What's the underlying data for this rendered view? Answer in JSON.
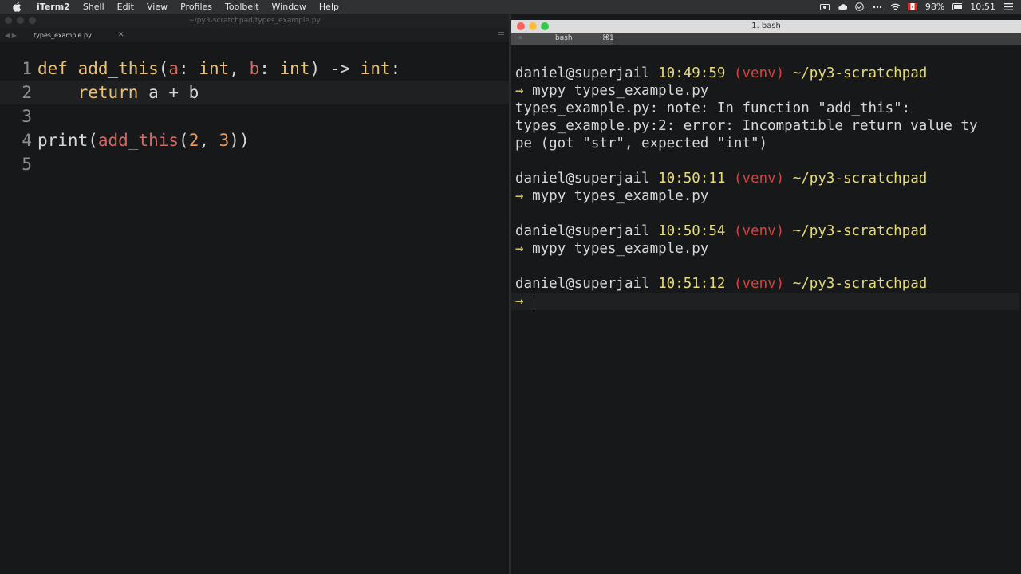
{
  "menubar": {
    "app": "iTerm2",
    "items": [
      "Shell",
      "Edit",
      "View",
      "Profiles",
      "Toolbelt",
      "Window",
      "Help"
    ],
    "battery": "98%",
    "clock": "10:51"
  },
  "editor": {
    "window_title": "~/py3-scratchpad/types_example.py",
    "tab_label": "types_example.py",
    "lines": [
      {
        "num": "1",
        "tokens": [
          {
            "t": "def ",
            "c": "kw"
          },
          {
            "t": "add_this",
            "c": "fn"
          },
          {
            "t": "(",
            "c": "pl"
          },
          {
            "t": "a",
            "c": "par"
          },
          {
            "t": ": ",
            "c": "pl"
          },
          {
            "t": "int",
            "c": "typ"
          },
          {
            "t": ", ",
            "c": "pl"
          },
          {
            "t": "b",
            "c": "par"
          },
          {
            "t": ": ",
            "c": "pl"
          },
          {
            "t": "int",
            "c": "typ"
          },
          {
            "t": ") -> ",
            "c": "pl"
          },
          {
            "t": "int",
            "c": "typ"
          },
          {
            "t": ":",
            "c": "pl"
          }
        ]
      },
      {
        "num": "2",
        "current": true,
        "tokens": [
          {
            "t": "    return",
            "c": "kw"
          },
          {
            "t": " a + b",
            "c": "pl"
          }
        ]
      },
      {
        "num": "3",
        "tokens": []
      },
      {
        "num": "4",
        "tokens": [
          {
            "t": "print",
            "c": "pl"
          },
          {
            "t": "(",
            "c": "pl"
          },
          {
            "t": "add_this",
            "c": "par"
          },
          {
            "t": "(",
            "c": "pl"
          },
          {
            "t": "2",
            "c": "num"
          },
          {
            "t": ", ",
            "c": "pl"
          },
          {
            "t": "3",
            "c": "num"
          },
          {
            "t": "))",
            "c": "pl"
          }
        ]
      },
      {
        "num": "5",
        "tokens": []
      }
    ]
  },
  "terminal": {
    "window_title": "1. bash",
    "tab_label": "bash",
    "tab_shortcut": "⌘1",
    "arrow": "→",
    "blocks": [
      {
        "user": "daniel@superjail",
        "time": "10:49:59",
        "venv": "(venv)",
        "path": "~/py3-scratchpad",
        "command": "mypy types_example.py",
        "output": [
          "types_example.py: note: In function \"add_this\":",
          "types_example.py:2: error: Incompatible return value ty",
          "pe (got \"str\", expected \"int\")"
        ]
      },
      {
        "user": "daniel@superjail",
        "time": "10:50:11",
        "venv": "(venv)",
        "path": "~/py3-scratchpad",
        "command": "mypy types_example.py",
        "output": []
      },
      {
        "user": "daniel@superjail",
        "time": "10:50:54",
        "venv": "(venv)",
        "path": "~/py3-scratchpad",
        "command": "mypy types_example.py",
        "output": []
      },
      {
        "user": "daniel@superjail",
        "time": "10:51:12",
        "venv": "(venv)",
        "path": "~/py3-scratchpad",
        "command": "",
        "output": [],
        "active": true
      }
    ]
  }
}
